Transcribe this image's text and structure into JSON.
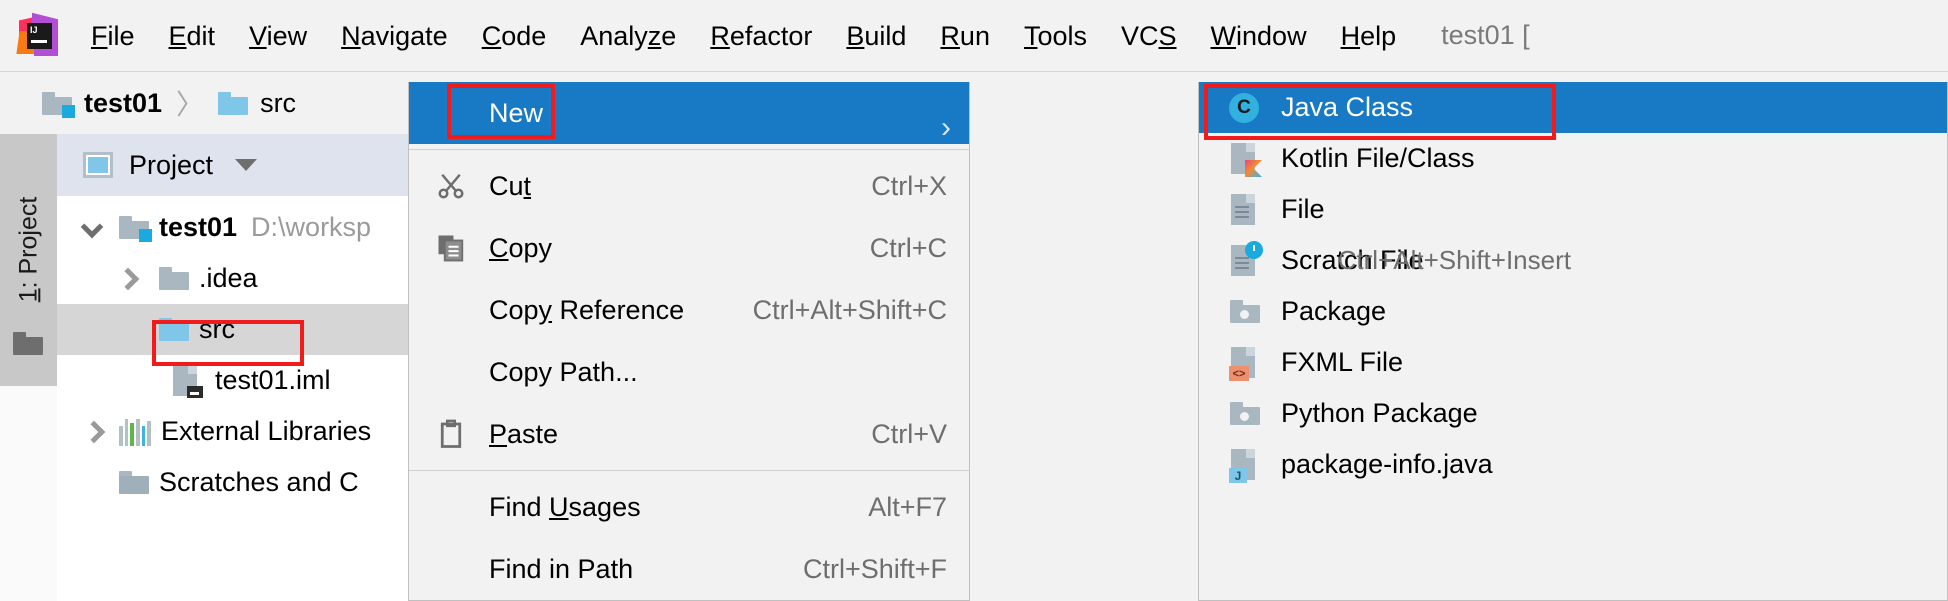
{
  "app": {
    "logo_text": "IJ",
    "window_title": "test01 ["
  },
  "menubar": {
    "items": [
      {
        "label": "File",
        "mnemonic": "F"
      },
      {
        "label": "Edit",
        "mnemonic": "E"
      },
      {
        "label": "View",
        "mnemonic": "V"
      },
      {
        "label": "Navigate",
        "mnemonic": "N"
      },
      {
        "label": "Code",
        "mnemonic": "C"
      },
      {
        "label": "Analyze",
        "mnemonic": "z"
      },
      {
        "label": "Refactor",
        "mnemonic": "R"
      },
      {
        "label": "Build",
        "mnemonic": "B"
      },
      {
        "label": "Run",
        "mnemonic": "R"
      },
      {
        "label": "Tools",
        "mnemonic": "T"
      },
      {
        "label": "VCS",
        "mnemonic": "S"
      },
      {
        "label": "Window",
        "mnemonic": "W"
      },
      {
        "label": "Help",
        "mnemonic": "H"
      }
    ]
  },
  "breadcrumb": {
    "separator": "〉",
    "items": [
      {
        "label": "test01",
        "icon": "module-folder-icon",
        "bold": true
      },
      {
        "label": "src",
        "icon": "source-folder-icon",
        "bold": false
      }
    ]
  },
  "toolstrip": {
    "label_prefix": "1",
    "label_suffix": ": Project",
    "mnemonic": "1"
  },
  "project_panel": {
    "header_title": "Project",
    "header_icon": "project-view-icon",
    "dropdown_icon": "chevron-down-icon",
    "tree": [
      {
        "label": "test01",
        "path": "D:\\worksp",
        "icon": "module-folder-icon",
        "arrow": "down",
        "indent": 0,
        "bold": true,
        "selected": false
      },
      {
        "label": ".idea",
        "path": "",
        "icon": "folder-icon",
        "arrow": "right",
        "indent": 1,
        "bold": false,
        "selected": false
      },
      {
        "label": "src",
        "path": "",
        "icon": "source-folder-icon",
        "arrow": "none",
        "indent": 1,
        "bold": false,
        "selected": true
      },
      {
        "label": "test01.iml",
        "path": "",
        "icon": "iml-file-icon",
        "arrow": "none",
        "indent": 2,
        "bold": false,
        "selected": false
      },
      {
        "label": "External Libraries",
        "path": "",
        "icon": "libraries-icon",
        "arrow": "right",
        "indent": 0,
        "bold": false,
        "selected": false
      },
      {
        "label": "Scratches and C",
        "path": "",
        "icon": "scratches-icon",
        "arrow": "none",
        "indent": 0,
        "bold": false,
        "selected": false
      }
    ]
  },
  "context_menu": {
    "items": [
      {
        "label": "New",
        "mnemonic": "",
        "icon": "",
        "shortcut": "",
        "highlight": true,
        "has_submenu": true
      },
      {
        "label": "Cut",
        "mnemonic": "t",
        "icon": "cut-icon",
        "shortcut": "Ctrl+X",
        "highlight": false,
        "has_submenu": false
      },
      {
        "label": "Copy",
        "mnemonic": "C",
        "icon": "copy-icon",
        "shortcut": "Ctrl+C",
        "highlight": false,
        "has_submenu": false
      },
      {
        "label": "Copy Reference",
        "mnemonic": "y",
        "icon": "",
        "shortcut": "Ctrl+Alt+Shift+C",
        "highlight": false,
        "has_submenu": false
      },
      {
        "label": "Copy Path...",
        "mnemonic": "",
        "icon": "",
        "shortcut": "",
        "highlight": false,
        "has_submenu": false
      },
      {
        "label": "Paste",
        "mnemonic": "P",
        "icon": "paste-icon",
        "shortcut": "Ctrl+V",
        "highlight": false,
        "has_submenu": false
      },
      {
        "label": "Find Usages",
        "mnemonic": "U",
        "icon": "",
        "shortcut": "Alt+F7",
        "highlight": false,
        "has_submenu": false
      },
      {
        "label": "Find in Path",
        "mnemonic": "",
        "icon": "",
        "shortcut": "Ctrl+Shift+F",
        "highlight": false,
        "has_submenu": false
      }
    ],
    "submenu_arrow": "›"
  },
  "submenu": {
    "items": [
      {
        "label": "Java Class",
        "icon": "java-class-icon",
        "shortcut": "",
        "highlight": true
      },
      {
        "label": "Kotlin File/Class",
        "icon": "kotlin-file-icon",
        "shortcut": "",
        "highlight": false
      },
      {
        "label": "File",
        "icon": "file-icon",
        "shortcut": "",
        "highlight": false
      },
      {
        "label": "Scratch File",
        "icon": "scratch-file-icon",
        "shortcut": "Ctrl+Alt+Shift+Insert",
        "highlight": false
      },
      {
        "label": "Package",
        "icon": "package-icon",
        "shortcut": "",
        "highlight": false
      },
      {
        "label": "FXML File",
        "icon": "fxml-file-icon",
        "shortcut": "",
        "highlight": false
      },
      {
        "label": "Python Package",
        "icon": "package-icon",
        "shortcut": "",
        "highlight": false
      },
      {
        "label": "package-info.java",
        "icon": "package-info-icon",
        "shortcut": "",
        "highlight": false
      }
    ]
  },
  "annotations": {
    "boxes": [
      {
        "name": "new-menu-item-highlight"
      },
      {
        "name": "java-class-item-highlight"
      },
      {
        "name": "src-node-highlight"
      }
    ],
    "color": "#f21b1b"
  },
  "colors": {
    "selection_blue": "#1879c4",
    "panel_bg": "#f2f2f2",
    "tree_selected": "#d6d6d6",
    "project_header": "#dfe3ed",
    "annotation_red": "#f21b1b",
    "folder_gray": "#a9b7c0",
    "folder_blue": "#7fc6e8"
  }
}
